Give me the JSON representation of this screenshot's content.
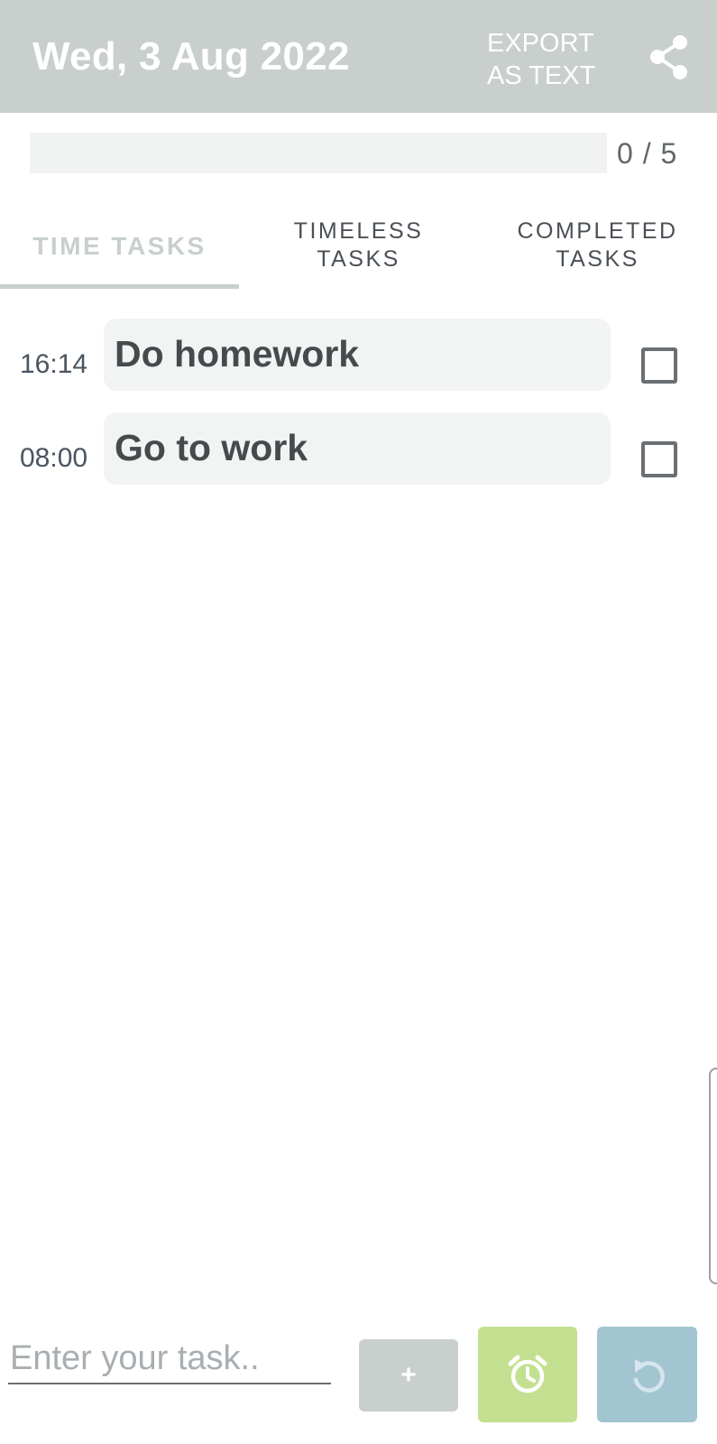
{
  "header": {
    "date": "Wed, 3 Aug 2022",
    "export_line1": "EXPORT",
    "export_line2": "AS TEXT",
    "share_icon": "share-icon"
  },
  "progress": {
    "completed": 0,
    "total": 5,
    "label": "0 / 5",
    "fraction": 0
  },
  "tabs": [
    {
      "line1": "TIME TASKS",
      "line2": "",
      "active": true
    },
    {
      "line1": "TIMELESS",
      "line2": "TASKS",
      "active": false
    },
    {
      "line1": "COMPLETED",
      "line2": "TASKS",
      "active": false
    }
  ],
  "tasks": [
    {
      "time": "16:14",
      "title": "Do homework",
      "done": false
    },
    {
      "time": "08:00",
      "title": "Go to work",
      "done": false
    }
  ],
  "composer": {
    "placeholder": "Enter your task..",
    "add_label": "+",
    "alarm_icon": "alarm-clock-icon",
    "undo_icon": "undo-icon"
  },
  "colors": {
    "header_bg": "#c8cfcc",
    "accent_green": "#c3e090",
    "accent_blue": "#a2c5d1",
    "text_dark": "#454a4d"
  }
}
